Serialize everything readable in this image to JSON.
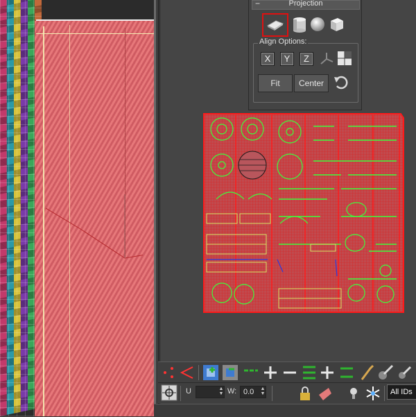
{
  "projection_rollout": {
    "title": "Projection",
    "collapse_symbol": "−",
    "projection_types": [
      "Planar",
      "Cylindrical",
      "Spherical",
      "Box"
    ],
    "selected_projection": "Planar",
    "align_options_label": "Align Options:",
    "axis_buttons": [
      "X",
      "Y",
      "Z"
    ],
    "fit_label": "Fit",
    "center_label": "Center"
  },
  "uv_editor": {
    "wire_color": "#ee1515",
    "uv_color": "#3cff3c",
    "selection": "all faces"
  },
  "toolbar_bottom": {
    "u_label": "U",
    "w_label": "W:",
    "w_value": "0.0",
    "ids_value": "All IDs"
  },
  "colors": {
    "accent_red": "#e01010",
    "uv_green": "#3cff3c",
    "panel_bg": "#444444"
  }
}
